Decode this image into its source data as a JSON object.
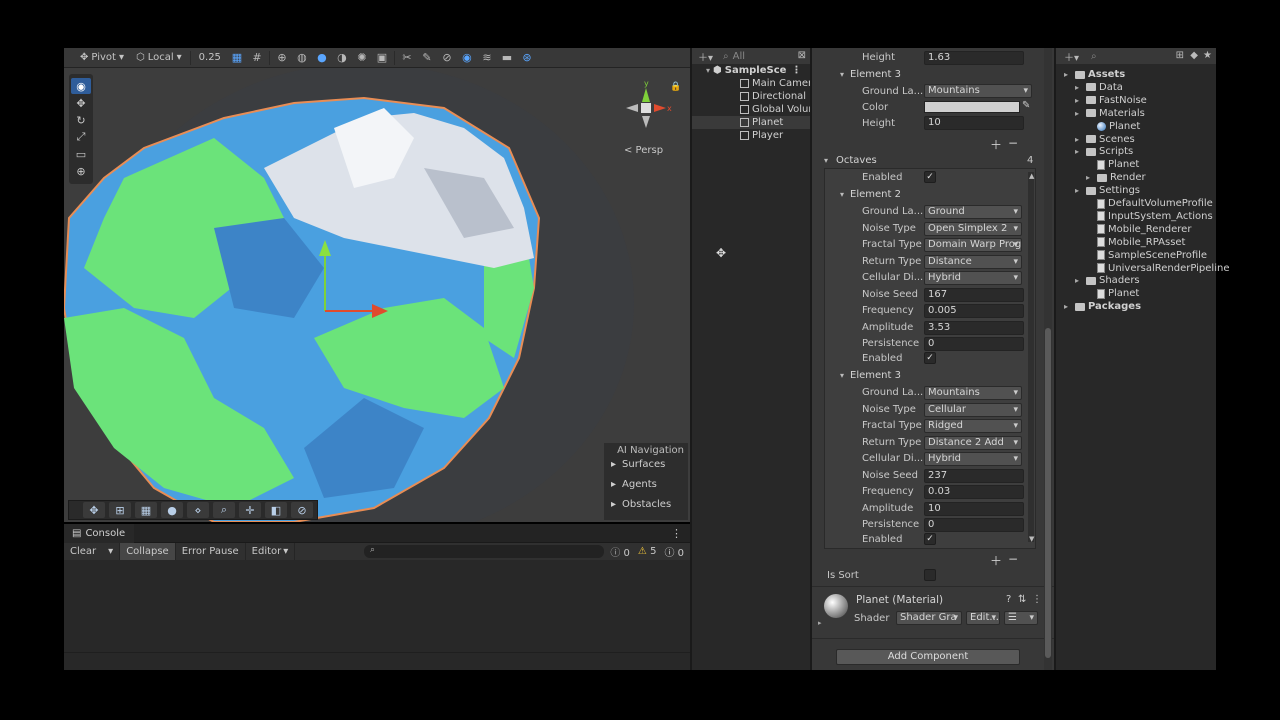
{
  "scene": {
    "toolbar": {
      "pivot_label": "Pivot",
      "local_label": "Local",
      "snap_value": "0.25"
    },
    "persp_label": "< Persp",
    "ai_navigation": {
      "title": "AI Navigation",
      "items": [
        "Surfaces",
        "Agents",
        "Obstacles"
      ]
    },
    "colors": {
      "ground": "#6be37a",
      "water": "#4a9fe3",
      "mountain": "#e6e9ee"
    }
  },
  "console": {
    "tab_label": "Console",
    "buttons": [
      "Clear",
      "Collapse",
      "Error Pause",
      "Editor"
    ],
    "counts": {
      "log": "0",
      "warning": "5",
      "error": "0"
    }
  },
  "hierarchy": {
    "search_placeholder": "All",
    "scene_name": "SampleSce",
    "items": [
      "Main Camera",
      "Directional L",
      "Global Volum",
      "Planet",
      "Player"
    ]
  },
  "inspector": {
    "top": {
      "height_label": "Height",
      "height_value": "1.63",
      "element3_label": "Element 3",
      "ground_label": "Ground La...",
      "ground_value": "Mountains",
      "color_label": "Color",
      "height2_label": "Height",
      "height2_value": "10"
    },
    "octaves": {
      "label": "Octaves",
      "count": "4",
      "enabled_label": "Enabled"
    },
    "element2": {
      "title": "Element 2",
      "fields": [
        {
          "label": "Ground La...",
          "value": "Ground",
          "kind": "dropdown"
        },
        {
          "label": "Noise Type",
          "value": "Open Simplex 2",
          "kind": "dropdown"
        },
        {
          "label": "Fractal Type",
          "value": "Domain Warp Prog",
          "kind": "dropdown"
        },
        {
          "label": "Return Type",
          "value": "Distance",
          "kind": "dropdown"
        },
        {
          "label": "Cellular Di...",
          "value": "Hybrid",
          "kind": "dropdown"
        },
        {
          "label": "Noise Seed",
          "value": "167",
          "kind": "text"
        },
        {
          "label": "Frequency",
          "value": "0.005",
          "kind": "text"
        },
        {
          "label": "Amplitude",
          "value": "3.53",
          "kind": "text"
        },
        {
          "label": "Persistence",
          "value": "0",
          "kind": "text"
        }
      ],
      "enabled_label": "Enabled"
    },
    "element3": {
      "title": "Element 3",
      "fields": [
        {
          "label": "Ground La...",
          "value": "Mountains",
          "kind": "dropdown"
        },
        {
          "label": "Noise Type",
          "value": "Cellular",
          "kind": "dropdown"
        },
        {
          "label": "Fractal Type",
          "value": "Ridged",
          "kind": "dropdown"
        },
        {
          "label": "Return Type",
          "value": "Distance 2 Add",
          "kind": "dropdown"
        },
        {
          "label": "Cellular Di...",
          "value": "Hybrid",
          "kind": "dropdown"
        },
        {
          "label": "Noise Seed",
          "value": "237",
          "kind": "text"
        },
        {
          "label": "Frequency",
          "value": "0.03",
          "kind": "text"
        },
        {
          "label": "Amplitude",
          "value": "10",
          "kind": "text"
        },
        {
          "label": "Persistence",
          "value": "0",
          "kind": "text"
        }
      ],
      "enabled_label": "Enabled"
    },
    "is_sort_label": "Is Sort",
    "material": {
      "name": "Planet (Material)",
      "shader_label": "Shader",
      "shader_value": "Shader Gra",
      "edit_label": "Edit..."
    },
    "add_component_label": "Add Component"
  },
  "project": {
    "tree": [
      {
        "label": "Assets",
        "indent": 0,
        "kind": "folder",
        "bold": true
      },
      {
        "label": "Data",
        "indent": 1,
        "kind": "folder"
      },
      {
        "label": "FastNoise",
        "indent": 1,
        "kind": "folder"
      },
      {
        "label": "Materials",
        "indent": 1,
        "kind": "folder"
      },
      {
        "label": "Planet",
        "indent": 2,
        "kind": "material"
      },
      {
        "label": "Scenes",
        "indent": 1,
        "kind": "folder"
      },
      {
        "label": "Scripts",
        "indent": 1,
        "kind": "folder"
      },
      {
        "label": "Planet",
        "indent": 2,
        "kind": "file"
      },
      {
        "label": "Render",
        "indent": 2,
        "kind": "folder"
      },
      {
        "label": "Settings",
        "indent": 1,
        "kind": "folder"
      },
      {
        "label": "DefaultVolumeProfile",
        "indent": 2,
        "kind": "file"
      },
      {
        "label": "InputSystem_Actions",
        "indent": 2,
        "kind": "file"
      },
      {
        "label": "Mobile_Renderer",
        "indent": 2,
        "kind": "file"
      },
      {
        "label": "Mobile_RPAsset",
        "indent": 2,
        "kind": "file"
      },
      {
        "label": "SampleSceneProfile",
        "indent": 2,
        "kind": "file"
      },
      {
        "label": "UniversalRenderPipeline",
        "indent": 2,
        "kind": "file"
      },
      {
        "label": "Shaders",
        "indent": 1,
        "kind": "folder"
      },
      {
        "label": "Planet",
        "indent": 2,
        "kind": "file"
      },
      {
        "label": "Packages",
        "indent": 0,
        "kind": "folder",
        "bold": true
      }
    ]
  }
}
